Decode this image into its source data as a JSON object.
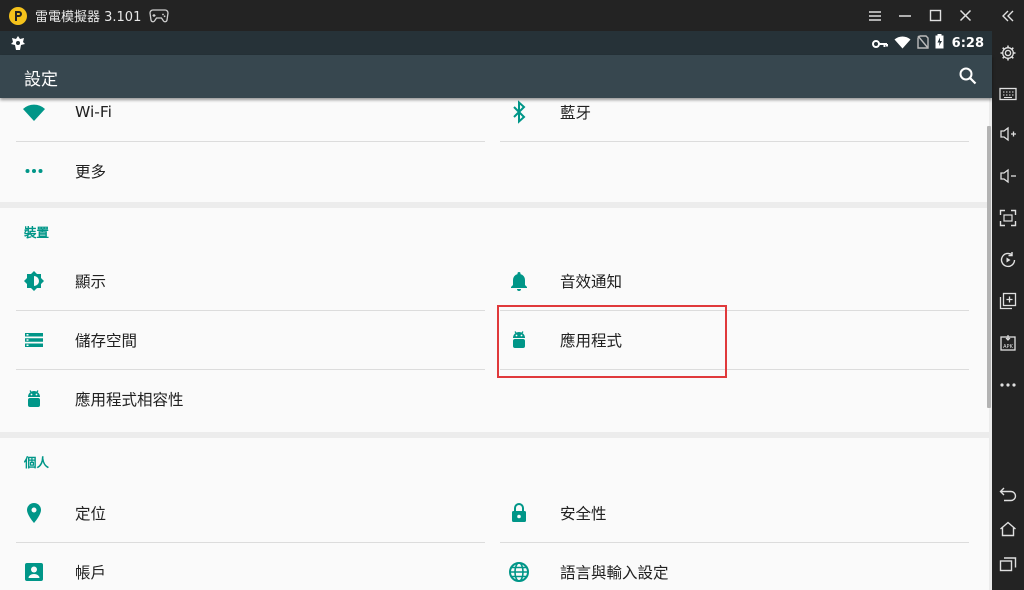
{
  "window": {
    "title": "雷電模擬器 3.101"
  },
  "status": {
    "time": "6:28"
  },
  "toolbar": {
    "title": "設定"
  },
  "sections": [
    {
      "header": "",
      "items": [
        {
          "label": "Wi-Fi",
          "icon": "wifi-icon"
        },
        {
          "label": "藍牙",
          "icon": "bluetooth-icon"
        },
        {
          "label": "更多",
          "icon": "more-dots-icon"
        }
      ]
    },
    {
      "header": "裝置",
      "items": [
        {
          "label": "顯示",
          "icon": "brightness-icon"
        },
        {
          "label": "音效通知",
          "icon": "bell-icon"
        },
        {
          "label": "儲存空間",
          "icon": "storage-icon"
        },
        {
          "label": "應用程式",
          "icon": "android-icon"
        },
        {
          "label": "應用程式相容性",
          "icon": "android-icon"
        }
      ]
    },
    {
      "header": "個人",
      "items": [
        {
          "label": "定位",
          "icon": "location-icon"
        },
        {
          "label": "安全性",
          "icon": "lock-icon"
        },
        {
          "label": "帳戶",
          "icon": "account-icon"
        },
        {
          "label": "語言與輸入設定",
          "icon": "globe-icon"
        }
      ]
    }
  ],
  "colors": {
    "accent": "#009688",
    "toolbar": "#37474f",
    "statusbar": "#263238",
    "highlight": "#e0393b"
  }
}
